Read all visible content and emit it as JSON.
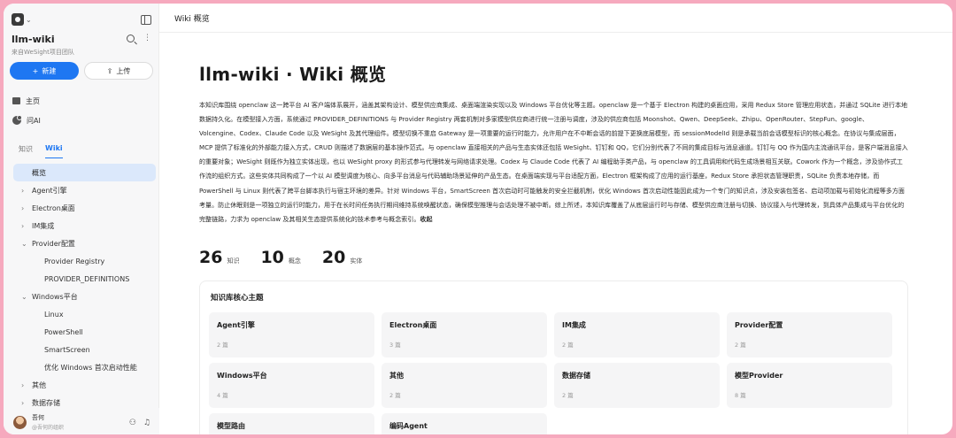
{
  "app": {
    "window_title": "Wiki 概览",
    "accent": "#1e77f2",
    "border_color": "#f6a9be"
  },
  "sidebar": {
    "repo_title": "llm-wiki",
    "repo_subtitle": "来自WeSight项目团队",
    "new_button": "新建",
    "upload_button": "上传",
    "nav": [
      {
        "label": "主页",
        "icon": "home-icon"
      },
      {
        "label": "问AI",
        "icon": "ai-chat-icon"
      }
    ],
    "tabs": [
      "知识",
      "Wiki"
    ],
    "active_tab": "Wiki",
    "tree": [
      {
        "label": "概览",
        "level": 0,
        "selected": true,
        "arrow": ""
      },
      {
        "label": "Agent引擎",
        "level": 0,
        "arrow": "›"
      },
      {
        "label": "Electron桌面",
        "level": 0,
        "arrow": "›"
      },
      {
        "label": "IM集成",
        "level": 0,
        "arrow": "›"
      },
      {
        "label": "Provider配置",
        "level": 0,
        "arrow": "⌄"
      },
      {
        "label": "Provider Registry",
        "level": 1,
        "arrow": ""
      },
      {
        "label": "PROVIDER_DEFINITIONS",
        "level": 1,
        "arrow": ""
      },
      {
        "label": "Windows平台",
        "level": 0,
        "arrow": "⌄"
      },
      {
        "label": "Linux",
        "level": 1,
        "arrow": ""
      },
      {
        "label": "PowerShell",
        "level": 1,
        "arrow": ""
      },
      {
        "label": "SmartScreen",
        "level": 1,
        "arrow": ""
      },
      {
        "label": "优化 Windows 首次启动性能",
        "level": 1,
        "arrow": ""
      },
      {
        "label": "其他",
        "level": 0,
        "arrow": "›"
      },
      {
        "label": "数据存储",
        "level": 0,
        "arrow": "›"
      }
    ],
    "user_name": "吾何",
    "user_org": "@吾何的组织"
  },
  "main": {
    "page_title": "llm-wiki · Wiki 概览",
    "summary": "本知识库围绕 openclaw 这一跨平台 AI 客户端体系展开，涵盖其架构设计、模型供应商集成、桌面端渲染实现以及 Windows 平台优化等主题。openclaw 是一个基于 Electron 构建的桌面应用，采用 Redux Store 管理应用状态，并通过 SQLite 进行本地数据持久化。在模型接入方面，系统通过 PROVIDER_DEFINITIONS 与 Provider Registry 两套机制对多家模型供应商进行统一注册与调度，涉及的供应商包括 Moonshot、Qwen、DeepSeek、Zhipu、OpenRouter、StepFun、google、Volcengine、Codex、Claude Code 以及 WeSight 及其代理组件。模型切换不重启 Gateway 是一项重要的运行时能力，允许用户在不中断会话的前提下更换底层模型，而 sessionModelId 则是承载当前会话模型标识的核心概念。在协议与集成层面，MCP 提供了标准化的外部能力接入方式，CRUD 则描述了数据层的基本操作范式。与 openclaw 直接相关的产品与生态实体还包括 WeSight、钉钉和 QQ，它们分别代表了不同的集成目标与消息通道。钉钉与 QQ 作为国内主流通讯平台，是客户端消息接入的重要对象；WeSight 则既作为独立实体出现，也以 WeSight proxy 的形式参与代理转发与网络请求处理。Codex 与 Claude Code 代表了 AI 编程助手类产品，与 openclaw 的工具调用和代码生成场景相互关联。Cowork 作为一个概念，涉及协作式工作流的组织方式。这些实体共同构成了一个以 AI 模型调度为核心、向多平台消息与代码辅助场景延伸的产品生态。在桌面端实现与平台适配方面，Electron 框架构成了应用的运行基座，Redux Store 承担状态管理职责，SQLite 负责本地存储，而 PowerShell 与 Linux 则代表了跨平台脚本执行与宿主环境的差异。针对 Windows 平台，SmartScreen 首次启动时可能触发的安全拦截机制，优化 Windows 首次启动性能因此成为一个专门的知识点，涉及安装包签名、启动项加载与初始化流程等多方面考量。防止休眠则是一项独立的运行时能力，用于在长时间任务执行期间维持系统唤醒状态，确保模型推理与会话处理不被中断。综上所述，本知识库覆盖了从底层运行时与存储、模型供应商注册与切换、协议接入与代理转发，到具体产品集成与平台优化的完整链路，力求为 openclaw 及其相关生态提供系统化的技术参考与概念索引。",
    "collapse_label": "收起",
    "stats": [
      {
        "value": "26",
        "label": "知识"
      },
      {
        "value": "10",
        "label": "概念"
      },
      {
        "value": "20",
        "label": "实体"
      }
    ],
    "topics_title": "知识库核心主题",
    "topics": [
      {
        "name": "Agent引擎",
        "count": "2 篇"
      },
      {
        "name": "Electron桌面",
        "count": "3 篇"
      },
      {
        "name": "IM集成",
        "count": "2 篇"
      },
      {
        "name": "Provider配置",
        "count": "2 篇"
      },
      {
        "name": "Windows平台",
        "count": "4 篇"
      },
      {
        "name": "其他",
        "count": "2 篇"
      },
      {
        "name": "数据存储",
        "count": "2 篇"
      },
      {
        "name": "模型Provider",
        "count": "8 篇"
      },
      {
        "name": "模型路由",
        "count": ""
      },
      {
        "name": "编码Agent",
        "count": ""
      }
    ]
  }
}
